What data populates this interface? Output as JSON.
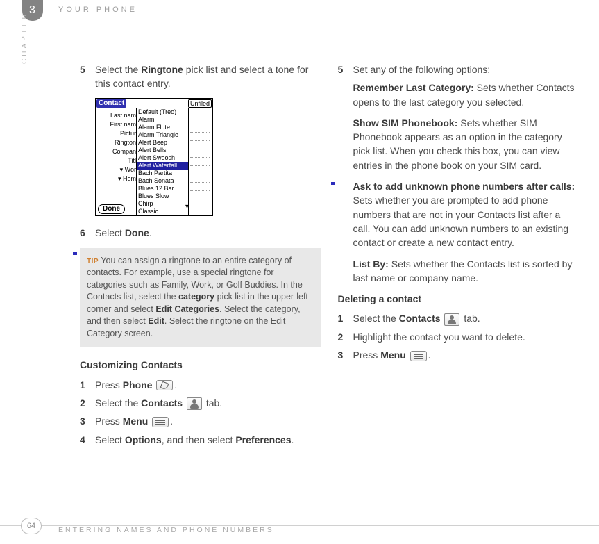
{
  "header": {
    "chapter_number": "3",
    "title": "YOUR PHONE",
    "chapter_label": "CHAPTER"
  },
  "left": {
    "step5_num": "5",
    "step5_a": "Select the ",
    "step5_b": "Ringtone",
    "step5_c": " pick list and select a tone for this contact entry.",
    "step6_num": "6",
    "step6_a": "Select ",
    "step6_b": "Done",
    "step6_c": ".",
    "cust_head": "Customizing Contacts",
    "c1_num": "1",
    "c1_a": "Press ",
    "c1_b": "Phone",
    "c1_c": ".",
    "c2_num": "2",
    "c2_a": "Select the ",
    "c2_b": "Contacts",
    "c2_c": " tab.",
    "c3_num": "3",
    "c3_a": "Press ",
    "c3_b": "Menu",
    "c3_c": ".",
    "c4_num": "4",
    "c4_a": "Select ",
    "c4_b": "Options",
    "c4_c": ", and then select ",
    "c4_d": "Preferences",
    "c4_e": "."
  },
  "screenshot": {
    "contact": "Contact",
    "unfiled": "Unfiled",
    "labels": [
      "Last nam",
      "First nam",
      "Pictur",
      "",
      "Rington",
      "Compan",
      "Titl",
      "▾ Wor",
      "▾ Hom"
    ],
    "list": [
      "Default (Treo)",
      "Alarm",
      "Alarm Flute",
      "Alarm Triangle",
      "Alert Beep",
      "Alert Bells",
      "Alert Swoosh",
      "Alert Waterfall",
      "Bach Partita",
      "Bach Sonata",
      "Blues 12 Bar",
      "Blues Slow",
      "Chirp",
      "Classic"
    ],
    "selected_index": 7,
    "done": "Done"
  },
  "tip": {
    "label": "TIP",
    "t1": " You can assign a ringtone to an entire category of contacts. For example, use a special ringtone for categories such as Family, Work, or Golf Buddies. In the Contacts list, select the ",
    "b1": "category",
    "t2": " pick list in the upper-left corner and select ",
    "b2": "Edit Categories",
    "t3": ". Select the category, and then select ",
    "b3": "Edit",
    "t4": ". Select the ringtone on the Edit Category screen."
  },
  "right": {
    "r5_num": "5",
    "r5_text": "Set any of the following options:",
    "opt1_b": "Remember Last Category:",
    "opt1_t": " Sets whether Contacts opens to the last category you selected.",
    "opt2_b": "Show SIM Phonebook:",
    "opt2_t": " Sets whether SIM Phonebook appears as an option in the category pick list. When you check this box, you can view entries in the phone book on your SIM card.",
    "opt3_b": "Ask to add unknown phone numbers after calls:",
    "opt3_t": " Sets whether you are prompted to add phone numbers that are not in your Contacts list after a call. You can add unknown numbers to an existing contact or create a new contact entry.",
    "opt4_b": "List By:",
    "opt4_t": " Sets whether the Contacts list is sorted by last name or company name.",
    "del_head": "Deleting a contact",
    "d1_num": "1",
    "d1_a": "Select the ",
    "d1_b": "Contacts",
    "d1_c": " tab.",
    "d2_num": "2",
    "d2_t": "Highlight the contact you want to delete.",
    "d3_num": "3",
    "d3_a": "Press ",
    "d3_b": "Menu",
    "d3_c": "."
  },
  "footer": {
    "page": "64",
    "title": "ENTERING NAMES AND PHONE NUMBERS"
  }
}
